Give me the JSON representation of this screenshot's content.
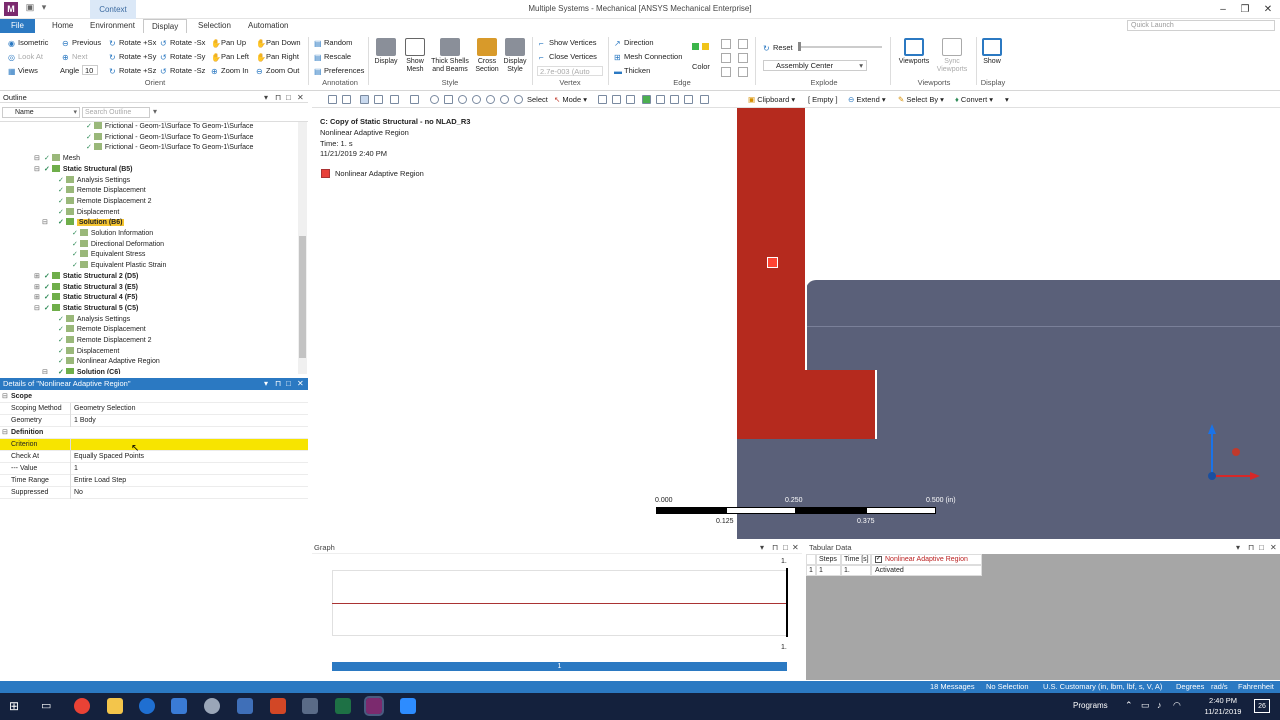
{
  "window": {
    "title": "Multiple Systems - Mechanical [ANSYS Mechanical Enterprise]",
    "context_tab": "Context",
    "app_badge": "M"
  },
  "tabs": [
    "File",
    "Home",
    "Environment",
    "Display",
    "Selection",
    "Automation"
  ],
  "active_tab": "Display",
  "quick_launch_placeholder": "Quick Launch",
  "ribbon": {
    "orient": {
      "row1": [
        "Isometric",
        "Previous",
        "Rotate +Sx",
        "Rotate -Sx",
        "Pan Up",
        "Pan Down"
      ],
      "row2": [
        "Look At",
        "Next",
        "Rotate +Sy",
        "Rotate -Sy",
        "Pan Left",
        "Pan Right"
      ],
      "row3": [
        "Views",
        "Angle",
        "Rotate +Sz",
        "Rotate -Sz",
        "Zoom In",
        "Zoom Out"
      ],
      "angle_value": "10",
      "group_label": "Orient"
    },
    "annotation": {
      "items": [
        "Random",
        "Rescale",
        "Preferences"
      ],
      "group_label": "Annotation"
    },
    "style": {
      "buttons": [
        "Display",
        "Show Mesh",
        "Thick Shells and Beams",
        "Cross Section",
        "Display Style"
      ],
      "group_label": "Style"
    },
    "vertex": {
      "items": [
        "Show Vertices",
        "Close Vertices"
      ],
      "value": "2.7e-003 (Auto",
      "group_label": "Vertex"
    },
    "edge": {
      "items": [
        "Direction",
        "Mesh Connection",
        "Thicken"
      ],
      "color_label": "Color",
      "group_label": "Edge"
    },
    "explode": {
      "reset": "Reset",
      "select_value": "Assembly Center",
      "group_label": "Explode"
    },
    "viewports": {
      "buttons": [
        "Viewports",
        "Sync Viewports"
      ],
      "group_label": "Viewports"
    },
    "display": {
      "button": "Show",
      "group_label": "Display"
    }
  },
  "outline": {
    "title": "Outline",
    "name_label": "Name",
    "search_placeholder": "Search Outline",
    "items": [
      {
        "label": "Frictional - Geom-1\\Surface To Geom-1\\Surface",
        "indent": 5
      },
      {
        "label": "Frictional - Geom-1\\Surface To Geom-1\\Surface",
        "indent": 5
      },
      {
        "label": "Frictional - Geom-1\\Surface To Geom-1\\Surface",
        "indent": 5
      },
      {
        "label": "Mesh",
        "indent": 2
      },
      {
        "label": "Static Structural (B5)",
        "indent": 2,
        "bold": true
      },
      {
        "label": "Analysis Settings",
        "indent": 3
      },
      {
        "label": "Remote Displacement",
        "indent": 3
      },
      {
        "label": "Remote Displacement 2",
        "indent": 3
      },
      {
        "label": "Displacement",
        "indent": 3
      },
      {
        "label": "Solution (B6)",
        "indent": 3,
        "bold": true,
        "selected": true
      },
      {
        "label": "Solution Information",
        "indent": 4
      },
      {
        "label": "Directional Deformation",
        "indent": 4
      },
      {
        "label": "Equivalent Stress",
        "indent": 4
      },
      {
        "label": "Equivalent Plastic Strain",
        "indent": 4
      },
      {
        "label": "Static Structural 2 (D5)",
        "indent": 2,
        "bold": true
      },
      {
        "label": "Static Structural 3 (E5)",
        "indent": 2,
        "bold": true
      },
      {
        "label": "Static Structural 4 (F5)",
        "indent": 2,
        "bold": true
      },
      {
        "label": "Static Structural 5 (C5)",
        "indent": 2,
        "bold": true
      },
      {
        "label": "Analysis Settings",
        "indent": 3
      },
      {
        "label": "Remote Displacement",
        "indent": 3
      },
      {
        "label": "Remote Displacement 2",
        "indent": 3
      },
      {
        "label": "Displacement",
        "indent": 3
      },
      {
        "label": "Nonlinear Adaptive Region",
        "indent": 3
      },
      {
        "label": "Solution (C6)",
        "indent": 3,
        "bold": true
      }
    ]
  },
  "details": {
    "title": "Details of \"Nonlinear Adaptive Region\"",
    "rows": [
      {
        "key": "Scope",
        "value": "",
        "category": true
      },
      {
        "key": "Scoping Method",
        "value": "Geometry Selection"
      },
      {
        "key": "Geometry",
        "value": "1 Body"
      },
      {
        "key": "Definition",
        "value": "",
        "category": true
      },
      {
        "key": "Criterion",
        "value": "",
        "highlight": true
      },
      {
        "key": "Check At",
        "value": "Equally Spaced Points"
      },
      {
        "key": "--- Value",
        "value": "1"
      },
      {
        "key": "Time Range",
        "value": "Entire Load Step"
      },
      {
        "key": "Suppressed",
        "value": "No"
      }
    ]
  },
  "viewport_toolbar": {
    "select": "Select",
    "mode": "Mode",
    "clipboard": "Clipboard",
    "empty": "[ Empty ]",
    "extend": "Extend",
    "select_by": "Select By",
    "convert": "Convert"
  },
  "viewport": {
    "info_title": "C: Copy of Static Structural - no NLAD_R3",
    "info_object": "Nonlinear Adaptive Region",
    "info_time": "Time: 1. s",
    "info_date": "11/21/2019 2:40 PM",
    "legend_label": "Nonlinear Adaptive Region",
    "legend_color": "#e8403a",
    "body_red": "#b52a1e",
    "body_slate": "#5a6079",
    "scale_labels": [
      "0.000",
      "0.250",
      "0.500 (in)"
    ],
    "scale_sub_labels": [
      "0.125",
      "0.375"
    ]
  },
  "graph": {
    "title": "Graph",
    "y_top": "1.",
    "x_right": "1.",
    "bar_label": "1"
  },
  "tabular": {
    "title": "Tabular Data",
    "headers": [
      "Steps",
      "Time [s]",
      "Nonlinear Adaptive Region"
    ],
    "rows": [
      [
        "1",
        "1",
        "1.",
        "Activated"
      ]
    ]
  },
  "status": {
    "messages": "18 Messages",
    "selection": "No Selection",
    "units": "U.S. Customary (in, lbm, lbf, s, V, A)",
    "angle": "Degrees",
    "rate": "rad/s",
    "temp": "Fahrenheit"
  },
  "taskbar": {
    "programs": "Programs",
    "time": "2:40 PM",
    "date": "11/21/2019",
    "notif": "26"
  }
}
